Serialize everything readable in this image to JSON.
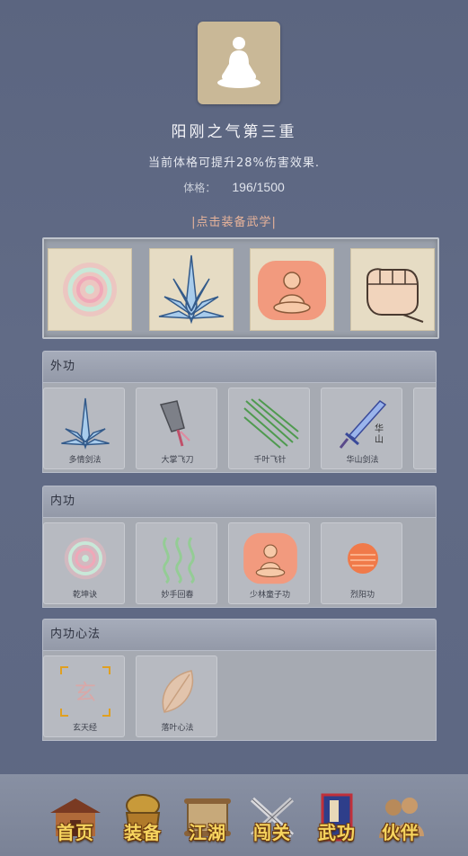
{
  "header": {
    "title": "阳刚之气第三重",
    "description": "当前体格可提升28%伤害效果.",
    "stat_label": "体格：",
    "stat_value": "196/1500",
    "equip_hint": "|点击装备武学|"
  },
  "equipped_slots": [
    {
      "icon": "spiral-icon"
    },
    {
      "icon": "blade-fan-icon"
    },
    {
      "icon": "monk-icon"
    },
    {
      "icon": "fist-icon"
    }
  ],
  "sections": [
    {
      "title": "外功",
      "cards": [
        {
          "name": "多情剑法",
          "icon": "blade-fan-icon"
        },
        {
          "name": "大掌飞刀",
          "icon": "cleaver-icon"
        },
        {
          "name": "千叶飞针",
          "icon": "needles-icon"
        },
        {
          "name": "华山剑法",
          "icon": "sword-icon"
        }
      ]
    },
    {
      "title": "内功",
      "cards": [
        {
          "name": "乾坤诀",
          "icon": "spiral-icon"
        },
        {
          "name": "妙手回春",
          "icon": "waves-icon"
        },
        {
          "name": "少林童子功",
          "icon": "monk-icon"
        },
        {
          "name": "烈阳功",
          "icon": "sun-icon"
        }
      ]
    },
    {
      "title": "内功心法",
      "cards": [
        {
          "name": "玄天经",
          "icon": "xuan-icon"
        },
        {
          "name": "落叶心法",
          "icon": "leaf-icon"
        }
      ]
    }
  ],
  "nav": [
    {
      "label": "首页",
      "icon": "house-icon"
    },
    {
      "label": "装备",
      "icon": "armor-icon"
    },
    {
      "label": "江湖",
      "icon": "scroll-icon"
    },
    {
      "label": "闯关",
      "icon": "swords-icon"
    },
    {
      "label": "武功",
      "icon": "book-icon"
    },
    {
      "label": "伙伴",
      "icon": "partners-icon"
    }
  ],
  "colors": {
    "background": "#5f6984",
    "equip_hint": "#e9b49a",
    "nav_label": "#f6d45e"
  }
}
